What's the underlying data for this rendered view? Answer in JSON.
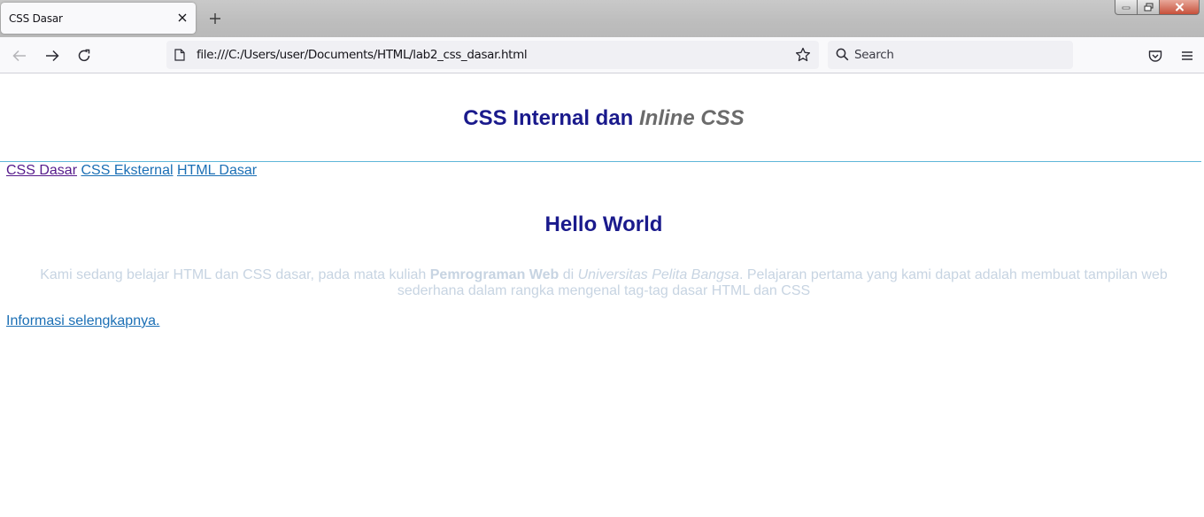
{
  "browser": {
    "tab_title": "CSS Dasar",
    "url": "file:///C:/Users/user/Documents/HTML/lab2_css_dasar.html",
    "search_placeholder": "Search",
    "accent_color": "#5fb6d9"
  },
  "icons": {
    "tab_close": "close-icon",
    "new_tab": "plus-icon",
    "back": "arrow-left-icon",
    "forward": "arrow-right-icon",
    "reload": "reload-icon",
    "page": "page-icon",
    "bookmark": "star-icon",
    "search": "search-icon",
    "pocket": "pocket-icon",
    "menu": "hamburger-menu-icon",
    "window_minimize": "minimize-icon",
    "window_restore": "restore-icon",
    "window_close": "window-close-icon"
  },
  "page": {
    "heading": {
      "part1": "CSS Internal dan ",
      "part2_italic": "Inline",
      "part3": " CSS",
      "color": "#1a1a8c"
    },
    "nav_links": [
      "CSS Dasar",
      "CSS Eksternal",
      "HTML Dasar"
    ],
    "hello_heading": "Hello World",
    "paragraph": {
      "text1": "Kami sedang belajar HTML dan CSS dasar, pada mata kuliah ",
      "bold": "Pemrograman Web",
      "text2": " di ",
      "italic": "Universitas Pelita Bangsa",
      "text3": ". Pelajaran pertama yang kami dapat adalah membuat tampilan web sederhana dalam rangka mengenal tag-tag dasar HTML dan CSS",
      "color": "#c7d4e2"
    },
    "more_link": "Informasi selengkapnya."
  }
}
